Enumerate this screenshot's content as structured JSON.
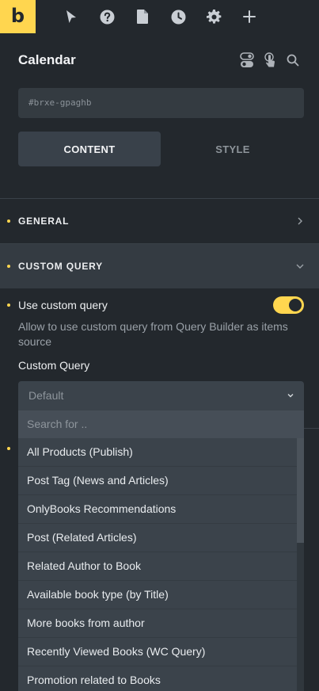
{
  "toolbar": {
    "logo": "b",
    "icons": [
      "cursor-icon",
      "help-icon",
      "page-icon",
      "history-icon",
      "settings-icon",
      "add-icon"
    ]
  },
  "panel": {
    "title": "Calendar",
    "header_icons": [
      "toggle-icon",
      "pointer-touch-icon",
      "search-icon"
    ],
    "css_id": "#brxe-gpaghb",
    "tabs": [
      {
        "label": "CONTENT",
        "active": true
      },
      {
        "label": "STYLE",
        "active": false
      }
    ]
  },
  "sections": {
    "general": {
      "label": "GENERAL",
      "expanded": false
    },
    "custom_query": {
      "label": "CUSTOM QUERY",
      "expanded": true
    }
  },
  "controls": {
    "use_custom_query": {
      "label": "Use custom query",
      "enabled": true,
      "description": "Allow to use custom query from Query Builder as items source"
    },
    "custom_query": {
      "label": "Custom Query",
      "selected": "Default",
      "search_placeholder": "Search for ..",
      "options": [
        "All Products (Publish)",
        "Post Tag (News and Articles)",
        "OnlyBooks Recommendations",
        "Post (Related Articles)",
        "Related Author to Book",
        "Available book type (by Title)",
        "More books from author",
        "Recently Viewed Books (WC Query)",
        "Promotion related to Books"
      ]
    }
  },
  "colors": {
    "accent": "#ffd64f",
    "panel_bg": "#23282d",
    "input_bg": "#343b41",
    "dropdown_bg": "#3b434b"
  }
}
